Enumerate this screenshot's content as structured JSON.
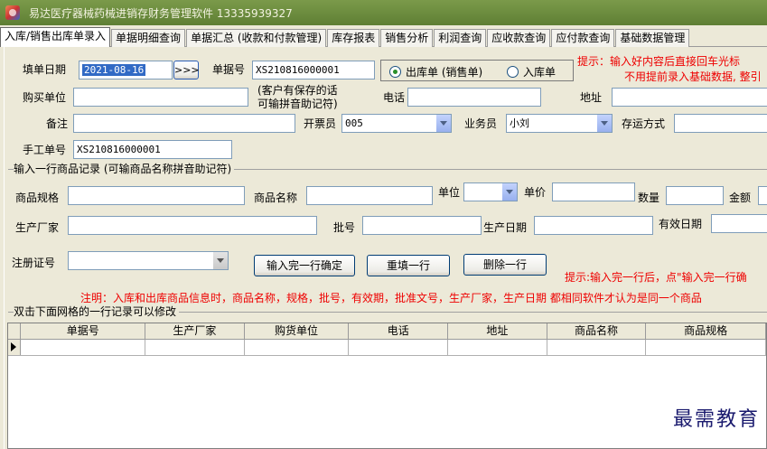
{
  "window": {
    "title": "易达医疗器械药械进销存财务管理软件 13335939327"
  },
  "tabs": [
    "入库/销售出库单录入",
    "单据明细查询",
    "单据汇总 (收款和付款管理)",
    "库存报表",
    "销售分析",
    "利润查询",
    "应收款查询",
    "应付款查询",
    "基础数据管理"
  ],
  "form": {
    "fill_date_label": "填单日期",
    "fill_date_value": "2021-08-16",
    "date_btn": ">>>",
    "doc_no_label": "单据号",
    "doc_no_value": "XS210816000001",
    "radio_out": "出库单 (销售单)",
    "radio_in": "入库单",
    "hint_line1": "提示：输入好内容后直接回车光标",
    "hint_line2": "不用提前录入基础数据, 整引",
    "buyer_label": "购买单位",
    "buyer_note_1": "(客户有保存的话",
    "buyer_note_2": "可输拼音助记符)",
    "phone_label": "电话",
    "address_label": "地址",
    "remark_label": "备注",
    "issuer_label": "开票员",
    "issuer_value": "005",
    "sales_label": "业务员",
    "sales_value": "小刘",
    "transport_label": "存运方式",
    "manual_no_label": "手工单号",
    "manual_no_value": "XS210816000001"
  },
  "item_section": {
    "title": "输入一行商品记录 (可输商品名称拼音助记符)",
    "spec_label": "商品规格",
    "name_label": "商品名称",
    "unit_label": "单位",
    "price_label": "单价",
    "qty_label": "数量",
    "amount_label": "金额",
    "maker_label": "生产厂家",
    "batch_label": "批号",
    "prod_date_label": "生产日期",
    "expiry_label": "有效日期",
    "reg_no_label": "注册证号",
    "confirm_btn": "输入完一行确定",
    "refill_btn": "重填一行",
    "delete_btn": "删除一行",
    "tip": "提示:输入完一行后，点\"输入完一行确",
    "note": "注明：入库和出库商品信息时，商品名称，规格，批号，有效期，批准文号，生产厂家，生产日期  都相同软件才认为是同一个商品"
  },
  "grid": {
    "title": "双击下面网格的一行记录可以修改",
    "columns": [
      "单据号",
      "生产厂家",
      "购货单位",
      "电话",
      "地址",
      "商品名称",
      "商品规格"
    ]
  },
  "watermark": "最需教育"
}
